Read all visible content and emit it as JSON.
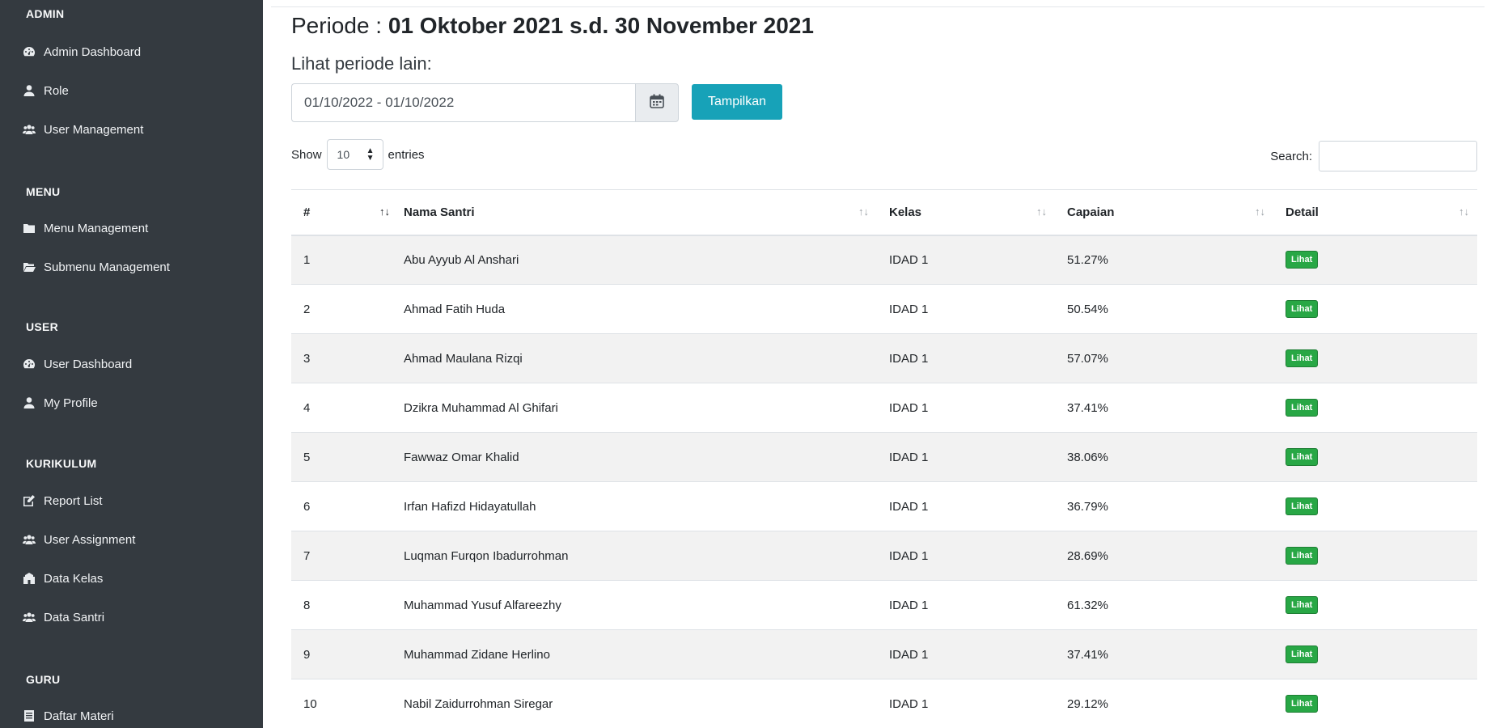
{
  "sidebar": {
    "sections": [
      {
        "heading": "ADMIN",
        "items": [
          {
            "label": "Admin Dashboard",
            "icon": "tachometer-icon"
          },
          {
            "label": "Role",
            "icon": "user-icon"
          },
          {
            "label": "User Management",
            "icon": "users-icon"
          }
        ]
      },
      {
        "heading": "MENU",
        "items": [
          {
            "label": "Menu Management",
            "icon": "folder-icon"
          },
          {
            "label": "Submenu Management",
            "icon": "folder-open-icon"
          }
        ]
      },
      {
        "heading": "USER",
        "items": [
          {
            "label": "User Dashboard",
            "icon": "tachometer-icon"
          },
          {
            "label": "My Profile",
            "icon": "user-icon"
          }
        ]
      },
      {
        "heading": "KURIKULUM",
        "items": [
          {
            "label": "Report List",
            "icon": "edit-icon"
          },
          {
            "label": "User Assignment",
            "icon": "users-icon"
          },
          {
            "label": "Data Kelas",
            "icon": "school-icon"
          },
          {
            "label": "Data Santri",
            "icon": "users-icon"
          }
        ]
      },
      {
        "heading": "GURU",
        "items": [
          {
            "label": "Daftar Materi",
            "icon": "list-icon"
          }
        ]
      }
    ]
  },
  "main": {
    "period_label": "Periode : ",
    "period_value": "01 Oktober 2021 s.d. 30 November 2021",
    "other_period_label": "Lihat periode lain:",
    "date_range_value": "01/10/2022 - 01/10/2022",
    "show_button": "Tampilkan",
    "length": {
      "prefix": "Show",
      "value": "10",
      "suffix": "entries"
    },
    "search_label": "Search:"
  },
  "table": {
    "columns": [
      "#",
      "",
      "Nama Santri",
      "Kelas",
      "Capaian",
      "Detail"
    ],
    "action_label": "Lihat",
    "rows": [
      {
        "no": "1",
        "nama": "Abu Ayyub Al Anshari",
        "kelas": "IDAD 1",
        "capaian": "51.27%"
      },
      {
        "no": "2",
        "nama": "Ahmad Fatih Huda",
        "kelas": "IDAD 1",
        "capaian": "50.54%"
      },
      {
        "no": "3",
        "nama": "Ahmad Maulana Rizqi",
        "kelas": "IDAD 1",
        "capaian": "57.07%"
      },
      {
        "no": "4",
        "nama": "Dzikra Muhammad Al Ghifari",
        "kelas": "IDAD 1",
        "capaian": "37.41%"
      },
      {
        "no": "5",
        "nama": "Fawwaz Omar Khalid",
        "kelas": "IDAD 1",
        "capaian": "38.06%"
      },
      {
        "no": "6",
        "nama": "Irfan Hafizd Hidayatullah",
        "kelas": "IDAD 1",
        "capaian": "36.79%"
      },
      {
        "no": "7",
        "nama": "Luqman Furqon Ibadurrohman",
        "kelas": "IDAD 1",
        "capaian": "28.69%"
      },
      {
        "no": "8",
        "nama": "Muhammad Yusuf Alfareezhy",
        "kelas": "IDAD 1",
        "capaian": "61.32%"
      },
      {
        "no": "9",
        "nama": "Muhammad Zidane Herlino",
        "kelas": "IDAD 1",
        "capaian": "37.41%"
      },
      {
        "no": "10",
        "nama": "Nabil Zaidurrohman Siregar",
        "kelas": "IDAD 1",
        "capaian": "29.12%"
      }
    ]
  }
}
